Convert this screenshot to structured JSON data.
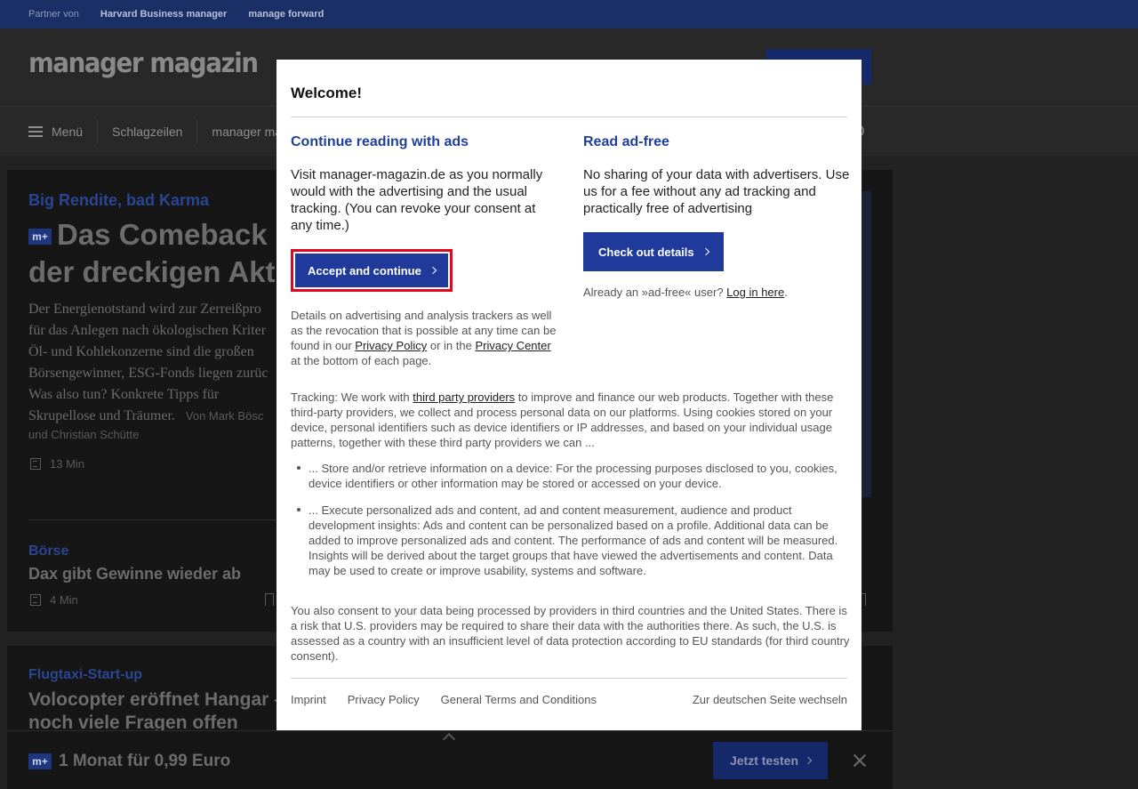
{
  "partner_bar": {
    "label": "Partner von",
    "links": [
      "Harvard Business manager",
      "manage forward"
    ]
  },
  "header": {
    "logo": "manager magazin"
  },
  "nav": {
    "menu_label": "Menü",
    "items": [
      "Schlagzeilen",
      "manager ma"
    ]
  },
  "article_main": {
    "kicker": "Big Rendite, bad Karma",
    "badge": "m+",
    "headline_line1": "Das Comeback",
    "headline_line2": "der dreckigen Aktie",
    "teaser_lines": [
      "Der Energienotstand wird zur Zerreißpro",
      "für das Anlegen nach ökologischen Kriter",
      "Öl- und Kohlekonzerne sind die großen",
      "Börsengewinner, ESG-Fonds liegen zurüc",
      "Was also tun? Konkrete Tipps für"
    ],
    "teaser_last": "Skrupellose und Träumer.",
    "author_a": "Von Mark Bösc",
    "author_b": "und Christian Schütte",
    "read_time": "13 Min"
  },
  "article_2": {
    "kicker": "Börse",
    "headline": "Dax gibt Gewinne wieder ab",
    "read_time": "4 Min"
  },
  "article_3": {
    "kicker": "Flugtaxi-Start-up",
    "headline_line1": "Volocopter eröffnet Hangar –",
    "headline_line2": "noch viele Fragen offen"
  },
  "promo": {
    "badge": "m+",
    "text": "1 Monat für 0,99 Euro",
    "button": "Jetzt testen"
  },
  "modal": {
    "title": "Welcome!",
    "left": {
      "heading": "Continue reading with ads",
      "body": "Visit manager-magazin.de as you normally would with the advertising and the usual tracking. (You can revoke your consent at any time.)",
      "button": "Accept and continue",
      "details_1": "Details on advertising and analysis trackers as well as the revocation that is possible at any time can be found in our",
      "privacy_policy_link": "Privacy Policy",
      "details_2": "or in the",
      "privacy_center_link": "Privacy Center",
      "details_3": "at the bottom of each page."
    },
    "right": {
      "heading": "Read ad-free",
      "body": "No sharing of your data with advertisers. Use us for a fee without any ad tracking and practically free of advertising",
      "button": "Check out details",
      "already_text": "Already an »ad-free« user?",
      "login_link": "Log in here",
      "already_end": "."
    },
    "tracking_prefix": "Tracking: We work with",
    "tracking_link": "third party providers",
    "tracking_rest": "to improve and finance our web products. Together with these third-party providers, we collect and process personal data on our platforms. Using cookies stored on your device, personal identifiers such as device identifiers or IP addresses, and based on your individual usage patterns, together with these third party providers we can ...",
    "bullets": [
      "... Store and/or retrieve information on a device: For the processing purposes disclosed to you, cookies, device identifiers or other information may be stored or accessed on your device.",
      "... Execute personalized ads and content, ad and content measurement, audience and product development insights: Ads and content can be personalized based on a profile. Additional data can be added to improve personalized ads and content. The performance of ads and content will be measured. Insights will be derived about the target groups that have viewed the advertisements and content. Data may be used to create or improve usability, systems and software."
    ],
    "consent_text": "You also consent to your data being processed by providers in third countries and the United States. There is a risk that U.S. providers may be required to share their data with the authorities there. As such, the U.S. is assessed as a country with an insufficient level of data protection according to EU standards (for third country consent).",
    "footer": {
      "imprint": "Imprint",
      "privacy": "Privacy Policy",
      "terms": "General Terms and Conditions",
      "switch": "Zur deutschen Seite wechseln"
    }
  },
  "colors": {
    "accent_blue": "#1f3a9a",
    "highlight_red": "#e0081f",
    "overlay": "#222222"
  }
}
